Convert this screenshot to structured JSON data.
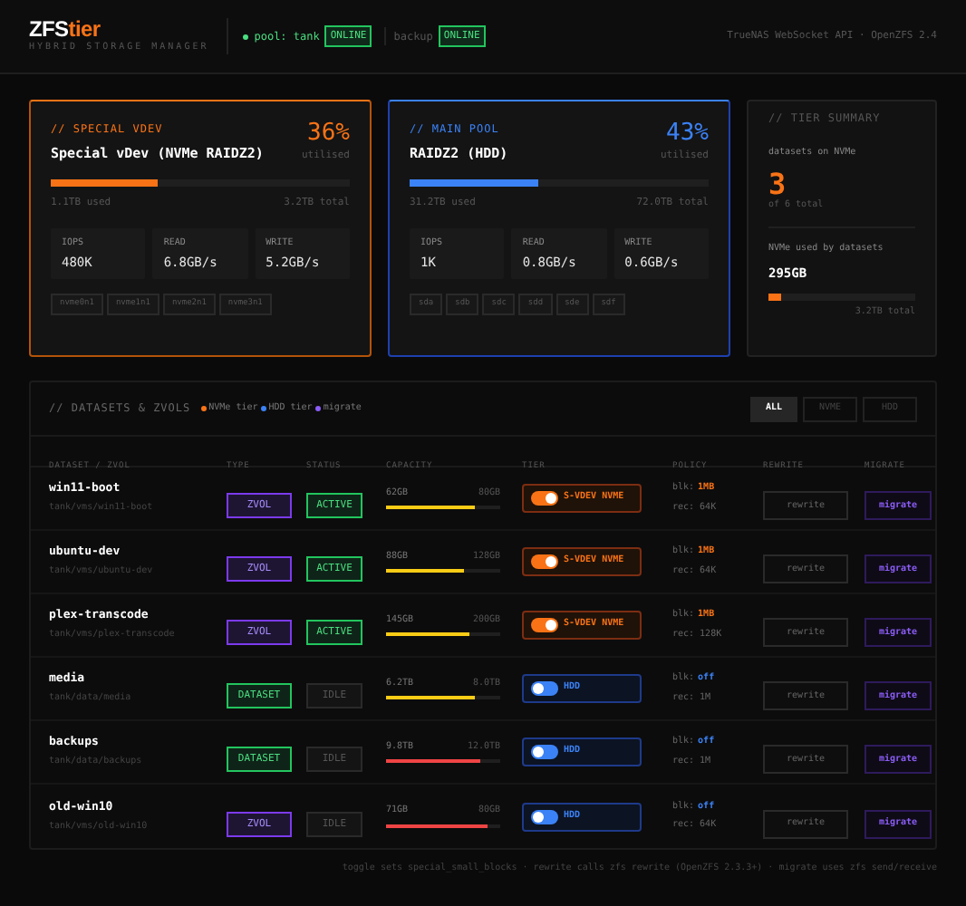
{
  "header": {
    "logo": {
      "main": "ZFS",
      "accent": "tier"
    },
    "subtitle": "HYBRID STORAGE MANAGER",
    "pool": {
      "label": "pool: tank",
      "status": "ONLINE"
    },
    "backup": {
      "label": "backup",
      "status": "ONLINE"
    },
    "info": "TrueNAS WebSocket API · OpenZFS 2.4"
  },
  "vdev_cards": [
    {
      "kind": "nvme",
      "eyebrow": "// SPECIAL VDEV",
      "title": "Special vDev (NVMe RAIDZ2)",
      "percent": "36%",
      "percent_label": "utilised",
      "level": 0.36,
      "used": "1.1TB used",
      "total": "3.2TB total",
      "stats": [
        {
          "label": "IOPS",
          "value": "480K"
        },
        {
          "label": "READ",
          "value": "6.8GB/s"
        },
        {
          "label": "WRITE",
          "value": "5.2GB/s"
        }
      ],
      "devices": [
        "nvme0n1",
        "nvme1n1",
        "nvme2n1",
        "nvme3n1"
      ]
    },
    {
      "kind": "hdd",
      "eyebrow": "// MAIN POOL",
      "title": "RAIDZ2 (HDD)",
      "percent": "43%",
      "percent_label": "utilised",
      "level": 0.43,
      "used": "31.2TB used",
      "total": "72.0TB total",
      "stats": [
        {
          "label": "IOPS",
          "value": "1K"
        },
        {
          "label": "READ",
          "value": "0.8GB/s"
        },
        {
          "label": "WRITE",
          "value": "0.6GB/s"
        }
      ],
      "devices": [
        "sda",
        "sdb",
        "sdc",
        "sdd",
        "sde",
        "sdf"
      ]
    }
  ],
  "tier_summary": {
    "title": "// TIER SUMMARY",
    "count_label": "datasets on NVMe",
    "count": "3",
    "count_sub": "of 6 total",
    "usage_label": "NVMe used by datasets",
    "usage": "295GB",
    "level": 0.09,
    "usage_total": "3.2TB total"
  },
  "datasets": {
    "title": "// DATASETS & ZVOLS",
    "legend": [
      {
        "label": "NVMe tier",
        "color": "#f97316"
      },
      {
        "label": "HDD tier",
        "color": "#3b82f6"
      },
      {
        "label": "migrate",
        "color": "#8b5cf6"
      }
    ],
    "filters": [
      {
        "label": "ALL",
        "selected": true
      },
      {
        "label": "NVME",
        "selected": false
      },
      {
        "label": "HDD",
        "selected": false
      }
    ],
    "columns": [
      "DATASET / ZVOL",
      "TYPE",
      "STATUS",
      "CAPACITY",
      "TIER",
      "POLICY",
      "REWRITE",
      "MIGRATE"
    ],
    "rows": [
      {
        "name": "win11-boot",
        "path": "tank/vms/win11-boot",
        "type": {
          "kind": "zvol",
          "label": "ZVOL"
        },
        "status": {
          "kind": "active",
          "label": "ACTIVE"
        },
        "used": "62GB",
        "size": "80GB",
        "level": 0.775,
        "nvme": true,
        "tier_label": "S-VDEV NVME",
        "blk_label": "blk:",
        "blk": "1MB",
        "rec": "rec: 64K",
        "rewrite": "rewrite",
        "migrate": "migrate"
      },
      {
        "name": "ubuntu-dev",
        "path": "tank/vms/ubuntu-dev",
        "type": {
          "kind": "zvol",
          "label": "ZVOL"
        },
        "status": {
          "kind": "active",
          "label": "ACTIVE"
        },
        "used": "88GB",
        "size": "128GB",
        "level": 0.69,
        "nvme": true,
        "tier_label": "S-VDEV NVME",
        "blk_label": "blk:",
        "blk": "1MB",
        "rec": "rec: 64K",
        "rewrite": "rewrite",
        "migrate": "migrate"
      },
      {
        "name": "plex-transcode",
        "path": "tank/vms/plex-transcode",
        "type": {
          "kind": "zvol",
          "label": "ZVOL"
        },
        "status": {
          "kind": "active",
          "label": "ACTIVE"
        },
        "used": "145GB",
        "size": "200GB",
        "level": 0.725,
        "nvme": true,
        "tier_label": "S-VDEV NVME",
        "blk_label": "blk:",
        "blk": "1MB",
        "rec": "rec: 128K",
        "rewrite": "rewrite",
        "migrate": "migrate"
      },
      {
        "name": "media",
        "path": "tank/data/media",
        "type": {
          "kind": "dataset",
          "label": "DATASET"
        },
        "status": {
          "kind": "idle",
          "label": "IDLE"
        },
        "used": "6.2TB",
        "size": "8.0TB",
        "level": 0.775,
        "nvme": false,
        "tier_label": "HDD",
        "blk_label": "blk:",
        "blk": "off",
        "rec": "rec: 1M",
        "rewrite": "rewrite",
        "migrate": "migrate"
      },
      {
        "name": "backups",
        "path": "tank/data/backups",
        "type": {
          "kind": "dataset",
          "label": "DATASET"
        },
        "status": {
          "kind": "idle",
          "label": "IDLE"
        },
        "used": "9.8TB",
        "size": "12.0TB",
        "level": 0.82,
        "nvme": false,
        "tier_label": "HDD",
        "blk_label": "blk:",
        "blk": "off",
        "rec": "rec: 1M",
        "rewrite": "rewrite",
        "migrate": "migrate"
      },
      {
        "name": "old-win10",
        "path": "tank/vms/old-win10",
        "type": {
          "kind": "zvol",
          "label": "ZVOL"
        },
        "status": {
          "kind": "idle",
          "label": "IDLE"
        },
        "used": "71GB",
        "size": "80GB",
        "level": 0.89,
        "nvme": false,
        "tier_label": "HDD",
        "blk_label": "blk:",
        "blk": "off",
        "rec": "rec: 64K",
        "rewrite": "rewrite",
        "migrate": "migrate"
      }
    ]
  },
  "footer": "toggle sets special_small_blocks · rewrite calls zfs rewrite (OpenZFS 2.3.3+) · migrate uses zfs send/receive"
}
